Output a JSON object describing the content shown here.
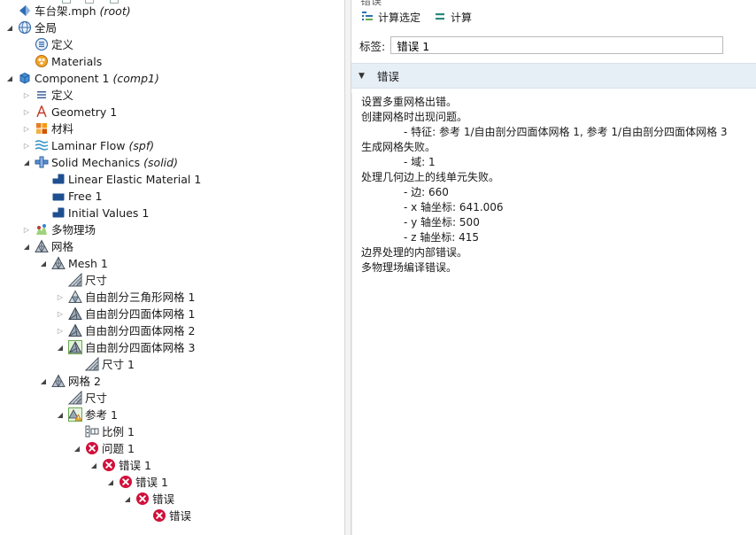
{
  "tree": [
    {
      "name": "root-file",
      "label": "车台架.mph",
      "suffix": "(root)",
      "icon": "model-root-icon",
      "toggle": "none",
      "level": 0,
      "row": 0,
      "selected": false
    },
    {
      "name": "global",
      "label": "全局",
      "suffix": "",
      "icon": "globe-icon",
      "toggle": "expanded",
      "level": 0,
      "row": 1
    },
    {
      "name": "global-definitions",
      "label": "定义",
      "suffix": "",
      "icon": "definitions-icon",
      "toggle": "none",
      "level": 1,
      "row": 2
    },
    {
      "name": "materials",
      "label": "Materials",
      "suffix": "",
      "icon": "materials-icon",
      "toggle": "none",
      "level": 1,
      "row": 3
    },
    {
      "name": "component-1",
      "label": "Component 1",
      "suffix": "(comp1)",
      "icon": "component-cube-icon",
      "toggle": "expanded",
      "level": 0,
      "row": 4
    },
    {
      "name": "comp-definitions",
      "label": "定义",
      "suffix": "",
      "icon": "definitions-list-icon",
      "toggle": "collapsed",
      "level": 1,
      "row": 5
    },
    {
      "name": "geometry-1",
      "label": "Geometry 1",
      "suffix": "",
      "icon": "geometry-icon",
      "toggle": "collapsed",
      "level": 1,
      "row": 6
    },
    {
      "name": "comp-materials",
      "label": "材料",
      "suffix": "",
      "icon": "material-blocks-icon",
      "toggle": "collapsed",
      "level": 1,
      "row": 7
    },
    {
      "name": "laminar-flow",
      "label": "Laminar Flow",
      "suffix": "(spf)",
      "icon": "laminar-flow-icon",
      "toggle": "collapsed",
      "level": 1,
      "row": 8
    },
    {
      "name": "solid-mechanics",
      "label": "Solid Mechanics",
      "suffix": "(solid)",
      "icon": "solid-mechanics-icon",
      "toggle": "expanded",
      "level": 1,
      "row": 9
    },
    {
      "name": "linear-elastic-material-1",
      "label": "Linear Elastic Material 1",
      "suffix": "",
      "icon": "domain-feature-icon",
      "toggle": "none",
      "level": 2,
      "row": 10
    },
    {
      "name": "free-1",
      "label": "Free 1",
      "suffix": "",
      "icon": "boundary-feature-icon",
      "toggle": "none",
      "level": 2,
      "row": 11
    },
    {
      "name": "initial-values-1",
      "label": "Initial Values 1",
      "suffix": "",
      "icon": "domain-feature-icon",
      "toggle": "none",
      "level": 2,
      "row": 12
    },
    {
      "name": "multiphysics",
      "label": "多物理场",
      "suffix": "",
      "icon": "multiphysics-icon",
      "toggle": "collapsed",
      "level": 1,
      "row": 13
    },
    {
      "name": "mesh-group",
      "label": "网格",
      "suffix": "",
      "icon": "mesh-triangle-icon",
      "toggle": "expanded",
      "level": 1,
      "row": 14
    },
    {
      "name": "mesh-1",
      "label": "Mesh 1",
      "suffix": "",
      "icon": "mesh-triangle-icon",
      "toggle": "expanded",
      "level": 2,
      "row": 15
    },
    {
      "name": "size-1a",
      "label": "尺寸",
      "suffix": "",
      "icon": "size-icon",
      "toggle": "none",
      "level": 3,
      "row": 16
    },
    {
      "name": "free-triangular-1",
      "label": "自由剖分三角形网格 1",
      "suffix": "",
      "icon": "free-triangular-icon",
      "toggle": "collapsed",
      "level": 3,
      "row": 17
    },
    {
      "name": "free-tetrahedral-1",
      "label": "自由剖分四面体网格 1",
      "suffix": "",
      "icon": "free-tetrahedral-icon",
      "toggle": "collapsed",
      "level": 3,
      "row": 18
    },
    {
      "name": "free-tetrahedral-2",
      "label": "自由剖分四面体网格 2",
      "suffix": "",
      "icon": "free-tetrahedral-icon",
      "toggle": "collapsed",
      "level": 3,
      "row": 19
    },
    {
      "name": "free-tetrahedral-3",
      "label": "自由剖分四面体网格 3",
      "suffix": "",
      "icon": "free-tetrahedral-active-icon",
      "toggle": "expanded",
      "level": 3,
      "row": 20
    },
    {
      "name": "size-1b",
      "label": "尺寸 1",
      "suffix": "",
      "icon": "size-icon",
      "toggle": "none",
      "level": 4,
      "row": 21
    },
    {
      "name": "mesh-2",
      "label": "网格 2",
      "suffix": "",
      "icon": "mesh-triangle-icon",
      "toggle": "expanded",
      "level": 2,
      "row": 22
    },
    {
      "name": "size-2",
      "label": "尺寸",
      "suffix": "",
      "icon": "size-icon",
      "toggle": "none",
      "level": 3,
      "row": 23
    },
    {
      "name": "reference-1",
      "label": "参考 1",
      "suffix": "",
      "icon": "reference-warning-icon",
      "toggle": "expanded",
      "level": 3,
      "row": 24
    },
    {
      "name": "scale-1",
      "label": "比例 1",
      "suffix": "",
      "icon": "scale-icon",
      "toggle": "none",
      "level": 4,
      "row": 25
    },
    {
      "name": "problem-1",
      "label": "问题 1",
      "suffix": "",
      "icon": "error-icon",
      "toggle": "expanded",
      "level": 4,
      "row": 26
    },
    {
      "name": "error-1a",
      "label": "错误 1",
      "suffix": "",
      "icon": "error-icon",
      "toggle": "expanded",
      "level": 5,
      "row": 27
    },
    {
      "name": "error-1b",
      "label": "错误 1",
      "suffix": "",
      "icon": "error-icon",
      "toggle": "expanded",
      "level": 6,
      "row": 28
    },
    {
      "name": "error-group",
      "label": "错误",
      "suffix": "",
      "icon": "error-icon",
      "toggle": "expanded",
      "level": 7,
      "row": 29
    },
    {
      "name": "error-leaf",
      "label": "错误",
      "suffix": "",
      "icon": "error-icon",
      "toggle": "none",
      "level": 8,
      "row": 30
    }
  ],
  "panel": {
    "title": "错误",
    "toolbar": {
      "build_selected": "计算选定",
      "build_all": "计算"
    },
    "label_key": "标签:",
    "label_value": "错误 1",
    "section_title": "错误",
    "lines": [
      {
        "text": "设置多重网格出错。",
        "indent": false
      },
      {
        "text": "创建网格时出现问题。",
        "indent": false
      },
      {
        "text": "- 特征: 参考 1/自由剖分四面体网格 1, 参考 1/自由剖分四面体网格 3",
        "indent": true
      },
      {
        "text": "生成网格失败。",
        "indent": false
      },
      {
        "text": "- 域: 1",
        "indent": true
      },
      {
        "text": "处理几何边上的线单元失败。",
        "indent": false
      },
      {
        "text": "- 边: 660",
        "indent": true
      },
      {
        "text": "- x 轴坐标: 641.006",
        "indent": true
      },
      {
        "text": "- y 轴坐标: 500",
        "indent": true
      },
      {
        "text": "- z 轴坐标: 415",
        "indent": true
      },
      {
        "text": "边界处理的内部错误。",
        "indent": false
      },
      {
        "text": "多物理场编译错误。",
        "indent": false
      }
    ]
  },
  "colors": {
    "error_red": "#d0103a",
    "accent_blue": "#1e5ea8",
    "section_bg": "#e6eef6"
  }
}
